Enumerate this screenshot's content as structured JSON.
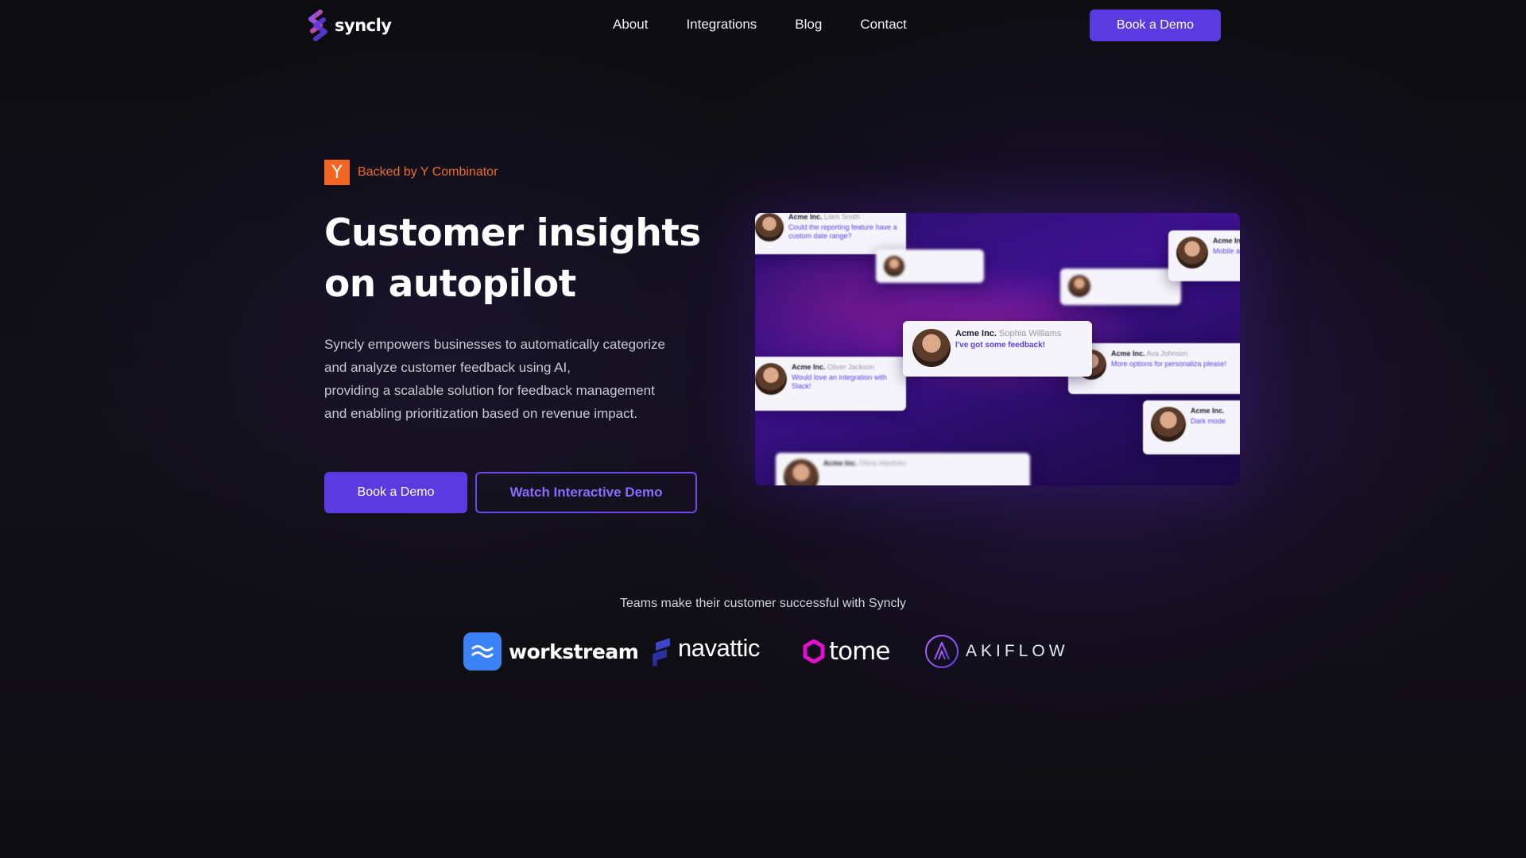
{
  "brand": {
    "name": "syncly",
    "accent": "#5a3be0",
    "logo_colors": [
      "#6c4bf4",
      "#e0467c"
    ]
  },
  "nav": {
    "links": [
      "About",
      "Integrations",
      "Blog",
      "Contact"
    ],
    "cta_label": "Book a Demo"
  },
  "hero": {
    "badge_logo_letter": "Y",
    "badge_text": "Backed by Y Combinator",
    "badge_color": "#f26522",
    "title_line1": "Customer insights",
    "title_line2": "on autopilot",
    "description": [
      "Syncly empowers businesses to automatically categorize",
      "and analyze customer feedback using AI,",
      "providing a scalable solution for feedback management",
      "and enabling prioritization based on revenue impact."
    ],
    "primary_button": "Book a Demo",
    "secondary_button": "Watch Interactive Demo"
  },
  "hero_visual": {
    "cards": [
      {
        "company": "Acme Inc.",
        "person": "Sophia Williams",
        "message": "I've got some feedback!"
      },
      {
        "company": "Acme Inc.",
        "person": "Oliver Jackson",
        "message": "Would love an integration with Slack!"
      },
      {
        "company": "Acme Inc.",
        "person": "Ava Johnson",
        "message": "More options for personaliza please!"
      },
      {
        "company": "Acme Inc.",
        "person": "Liam Smith",
        "message": "Could the reporting feature have a custom date range?"
      },
      {
        "company": "Acme In",
        "person": "",
        "message": "Mobile a"
      },
      {
        "company": "Acme Inc.",
        "person": "",
        "message": "Dark mode"
      },
      {
        "company": "Acme Inc.",
        "person": "Olivia Martinez",
        "message": ""
      }
    ]
  },
  "logos": {
    "caption": "Teams make their customer successful with Syncly",
    "items": [
      {
        "name": "workstream",
        "icon": "workstream-icon",
        "color": "#3b82f6"
      },
      {
        "name": "navattic",
        "icon": "navattic-icon",
        "color": "#3d44c9"
      },
      {
        "name": "tome",
        "icon": "tome-icon",
        "color": "#e10fd0"
      },
      {
        "name": "AKIFLOW",
        "icon": "akiflow-icon",
        "color": "#9b4ff0"
      }
    ]
  }
}
